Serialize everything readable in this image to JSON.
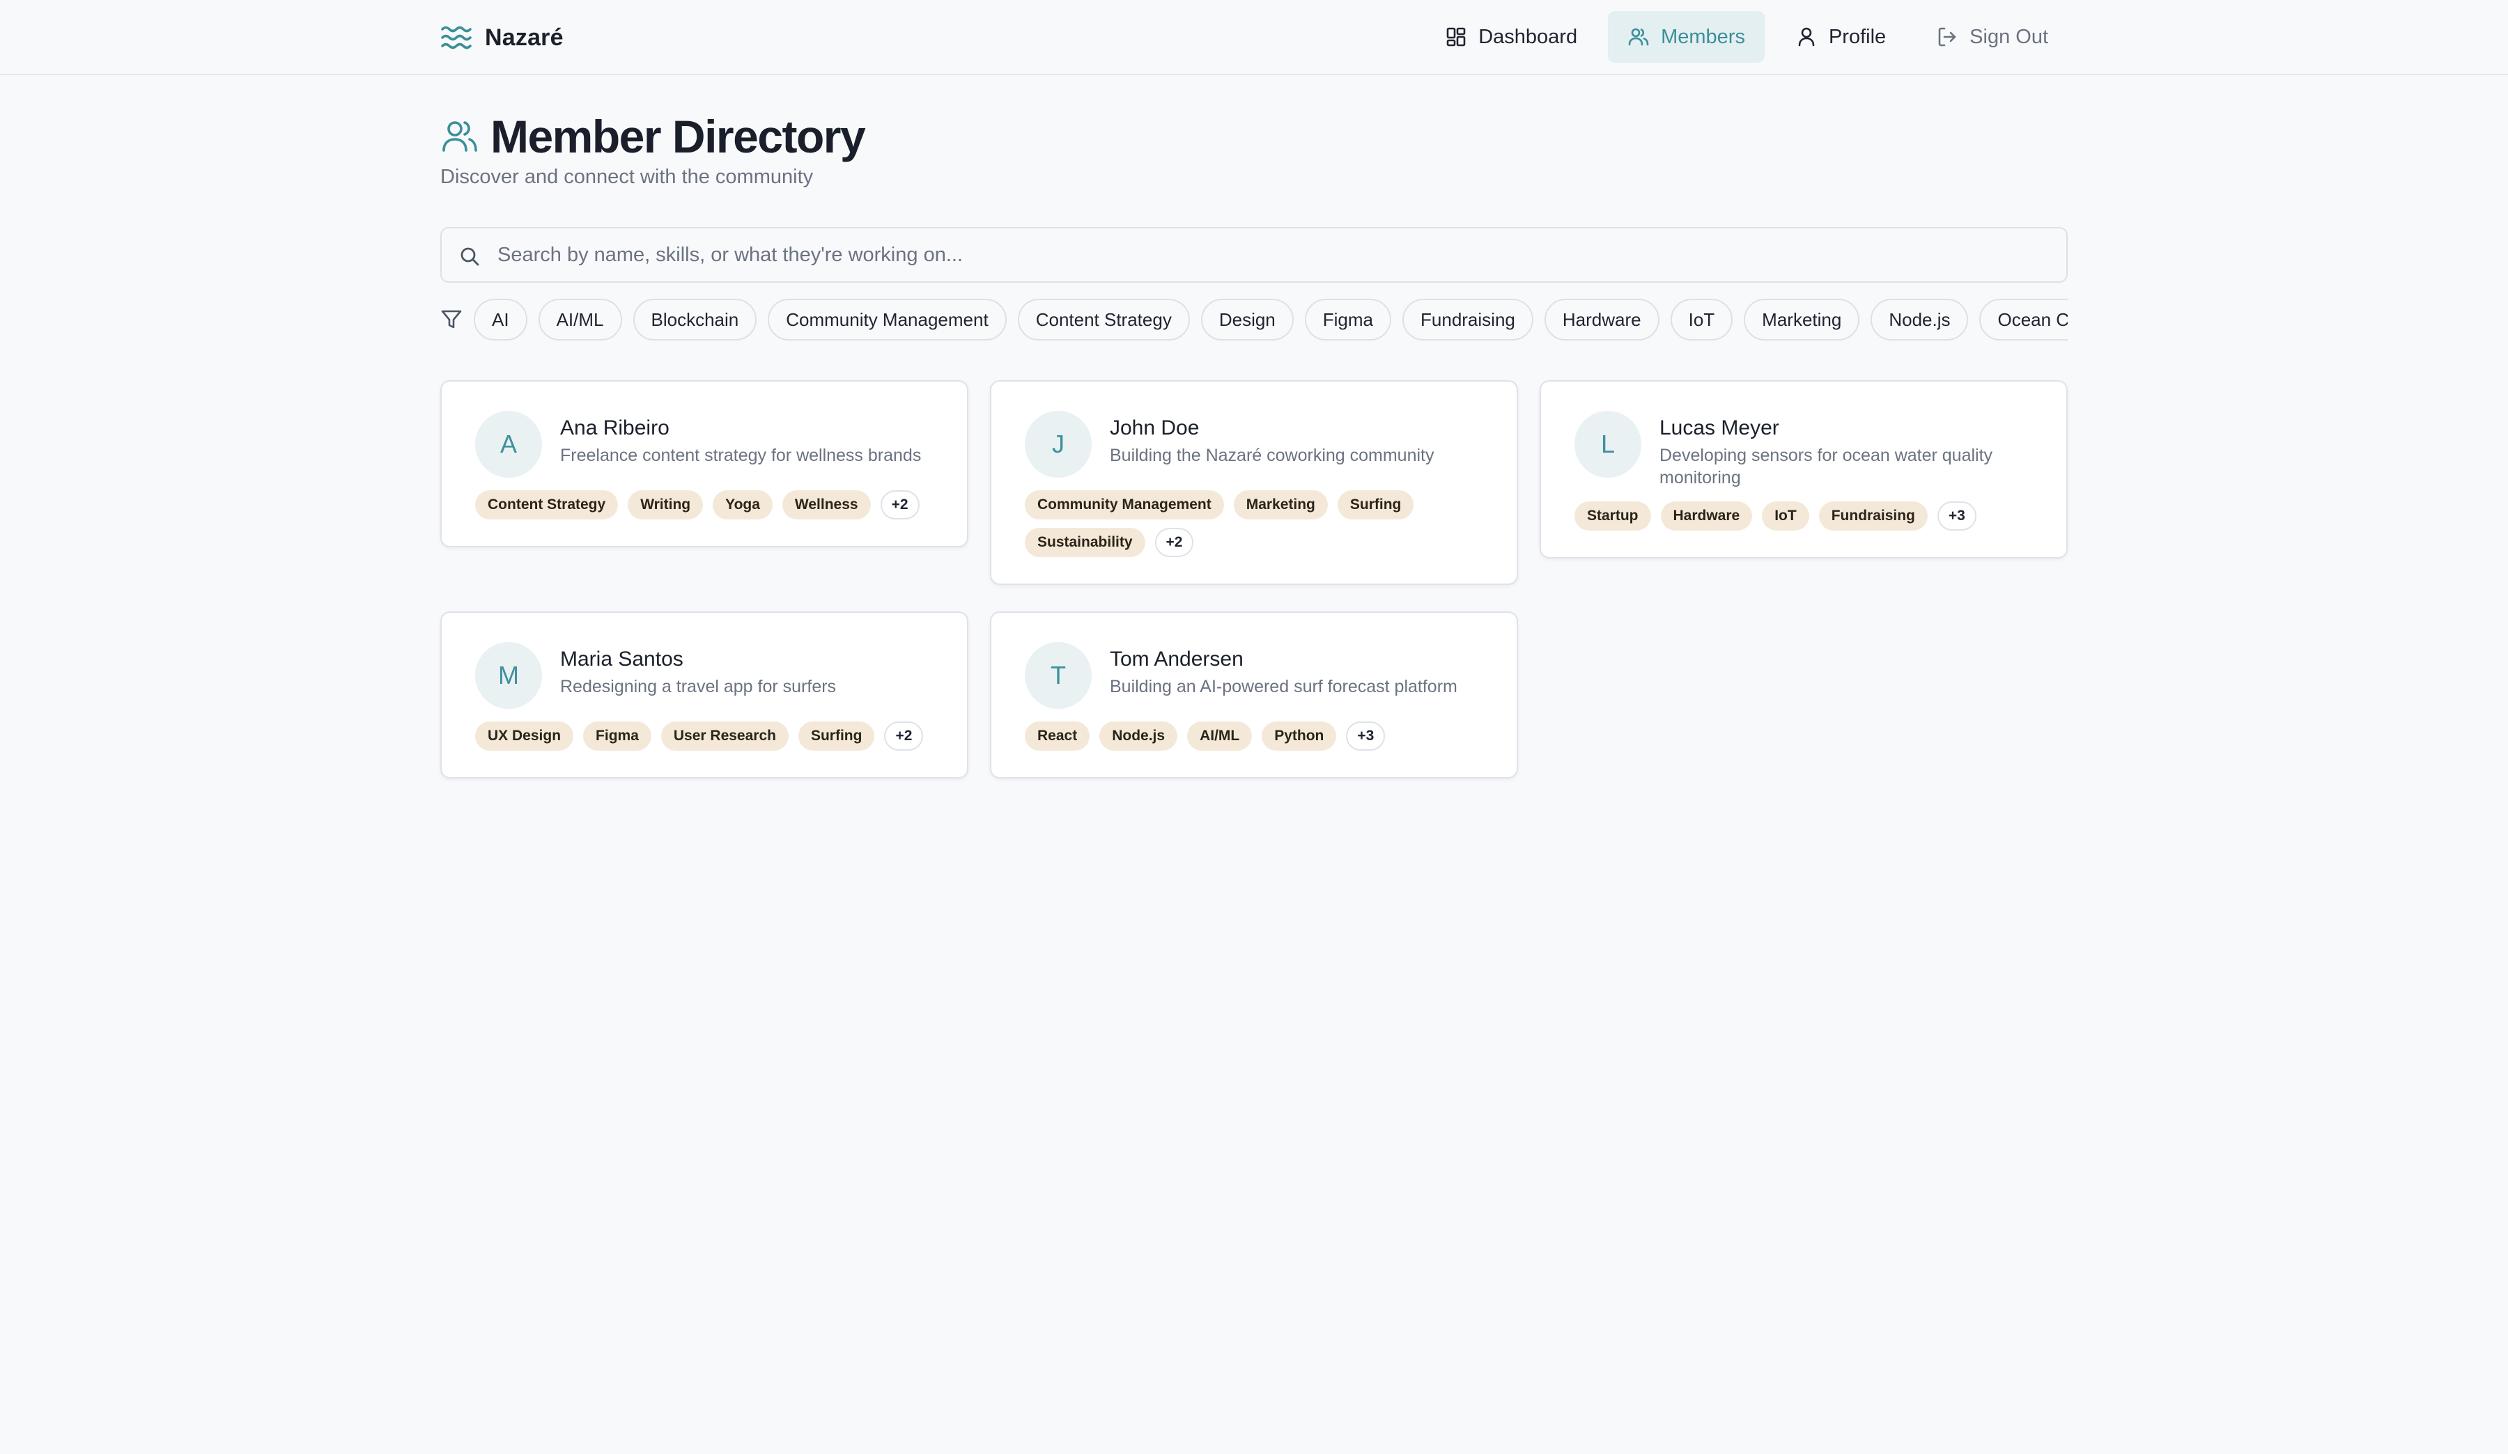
{
  "brand": {
    "name": "Nazaré"
  },
  "nav": {
    "dashboard": "Dashboard",
    "members": "Members",
    "profile": "Profile",
    "sign_out": "Sign Out"
  },
  "page": {
    "title": "Member Directory",
    "subtitle": "Discover and connect with the community"
  },
  "search": {
    "placeholder": "Search by name, skills, or what they're working on..."
  },
  "filters": [
    "AI",
    "AI/ML",
    "Blockchain",
    "Community Management",
    "Content Strategy",
    "Design",
    "Figma",
    "Fundraising",
    "Hardware",
    "IoT",
    "Marketing",
    "Node.js",
    "Ocean Conservation"
  ],
  "members": [
    {
      "initial": "A",
      "name": "Ana Ribeiro",
      "bio": "Freelance content strategy for wellness brands",
      "tags": [
        "Content Strategy",
        "Writing",
        "Yoga",
        "Wellness"
      ],
      "more": "+2"
    },
    {
      "initial": "J",
      "name": "John Doe",
      "bio": "Building the Nazaré coworking community",
      "tags": [
        "Community Management",
        "Marketing",
        "Surfing",
        "Sustainability"
      ],
      "more": "+2"
    },
    {
      "initial": "L",
      "name": "Lucas Meyer",
      "bio": "Developing sensors for ocean water quality monitoring",
      "tags": [
        "Startup",
        "Hardware",
        "IoT",
        "Fundraising"
      ],
      "more": "+3"
    },
    {
      "initial": "M",
      "name": "Maria Santos",
      "bio": "Redesigning a travel app for surfers",
      "tags": [
        "UX Design",
        "Figma",
        "User Research",
        "Surfing"
      ],
      "more": "+2"
    },
    {
      "initial": "T",
      "name": "Tom Andersen",
      "bio": "Building an AI-powered surf forecast platform",
      "tags": [
        "React",
        "Node.js",
        "AI/ML",
        "Python"
      ],
      "more": "+3"
    }
  ]
}
